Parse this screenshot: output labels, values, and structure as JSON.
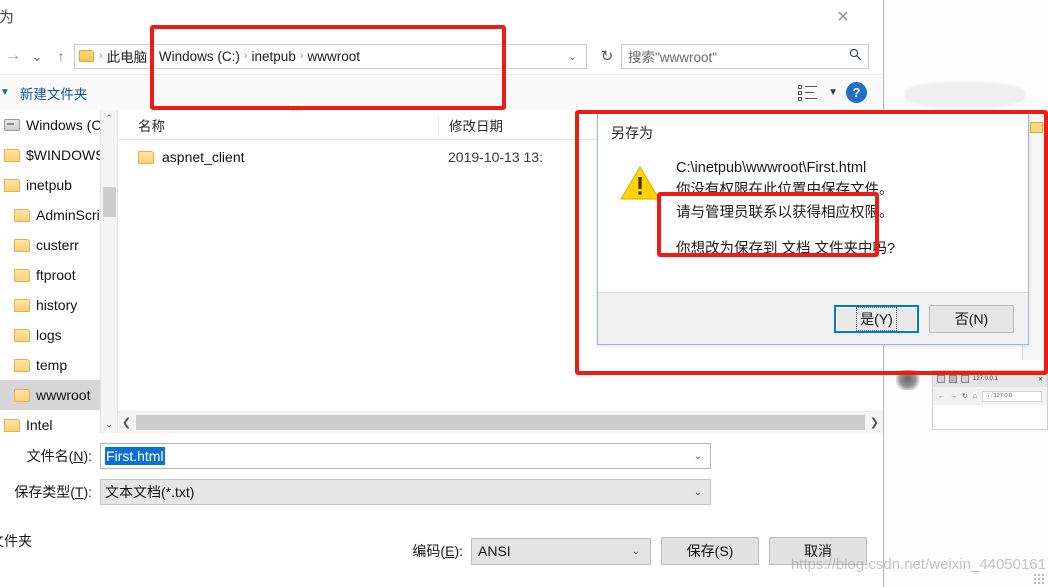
{
  "window": {
    "title": "存为",
    "close_label": "✕"
  },
  "addressbar": {
    "back_icon": "→",
    "history_caret": "⌄",
    "up_icon": "↑",
    "folder_icon": "folder-icon",
    "crumbs": [
      "此电脑",
      "Windows (C:)",
      "inetpub",
      "wwwroot"
    ],
    "separator": "›",
    "dropdown_caret": "⌄",
    "refresh_icon": "↻"
  },
  "search": {
    "placeholder": "搜索\"wwwroot\"",
    "icon": "search-icon"
  },
  "toolbar": {
    "organize_caret": "▼",
    "new_folder_label": "新建文件夹",
    "view_icon": "list-view-icon",
    "view_caret": "▼",
    "help_label": "?"
  },
  "tree": {
    "items": [
      {
        "label": "Windows (C:)",
        "icon": "drive-icon",
        "indent": 0,
        "selected": false
      },
      {
        "label": "$WINDOWS.",
        "icon": "folder-icon",
        "indent": 0,
        "selected": false
      },
      {
        "label": "inetpub",
        "icon": "folder-icon",
        "indent": 0,
        "selected": false
      },
      {
        "label": "AdminScrip",
        "icon": "folder-icon",
        "indent": 1,
        "selected": false
      },
      {
        "label": "custerr",
        "icon": "folder-icon",
        "indent": 1,
        "selected": false
      },
      {
        "label": "ftproot",
        "icon": "folder-icon",
        "indent": 1,
        "selected": false
      },
      {
        "label": "history",
        "icon": "folder-icon",
        "indent": 1,
        "selected": false
      },
      {
        "label": "logs",
        "icon": "folder-icon",
        "indent": 1,
        "selected": false
      },
      {
        "label": "temp",
        "icon": "folder-icon",
        "indent": 1,
        "selected": false
      },
      {
        "label": "wwwroot",
        "icon": "folder-icon",
        "indent": 1,
        "selected": true
      },
      {
        "label": "Intel",
        "icon": "folder-icon",
        "indent": 0,
        "selected": false
      }
    ],
    "scroll_up": "⌃",
    "scroll_down": "⌄"
  },
  "filelist": {
    "columns": {
      "name": "名称",
      "date": "修改日期"
    },
    "sort_caret": "⌃",
    "rows": [
      {
        "name": "aspnet_client",
        "date": "2019-10-13 13:",
        "icon": "folder-icon"
      }
    ],
    "hscroll_left": "❮",
    "hscroll_right": "❯"
  },
  "form": {
    "filename_label": "文件名(N):",
    "filename_value": "First.html",
    "filename_caret": "⌄",
    "filetype_label": "保存类型(T):",
    "filetype_value": "文本文档(*.txt)",
    "filetype_caret": "⌄",
    "encoding_label": "编码(E):",
    "encoding_value": "ANSI",
    "encoding_caret": "⌄",
    "save_button": "保存(S)",
    "cancel_button": "取消",
    "footer_left": "文件夹"
  },
  "modal": {
    "title": "另存为",
    "warning_icon": "warning-triangle-icon",
    "path": "C:\\inetpub\\wwwroot\\First.html",
    "line1": "你没有权限在此位置中保存文件。",
    "line2": "请与管理员联系以获得相应权限。",
    "question": "你想改为保存到 文档 文件夹中吗?",
    "yes_button": "是(Y)",
    "no_button": "否(N)"
  },
  "background": {
    "browser_tab_title": "127.0.0.1",
    "browser_url": "127.0.0",
    "back_icon": "←",
    "forward_icon": "→",
    "reload_icon": "↻",
    "home_icon": "⌂",
    "info_icon": "ⓘ",
    "close_tab_icon": "✕"
  },
  "watermark": {
    "text": "https://blog.csdn.net/weixin_44050161"
  },
  "colors": {
    "accent_blue": "#0078d7",
    "link_blue": "#16519e",
    "annotation_red": "#ee1c12",
    "selection_blue": "#0b6fd4",
    "warning_yellow": "#ffd400"
  }
}
